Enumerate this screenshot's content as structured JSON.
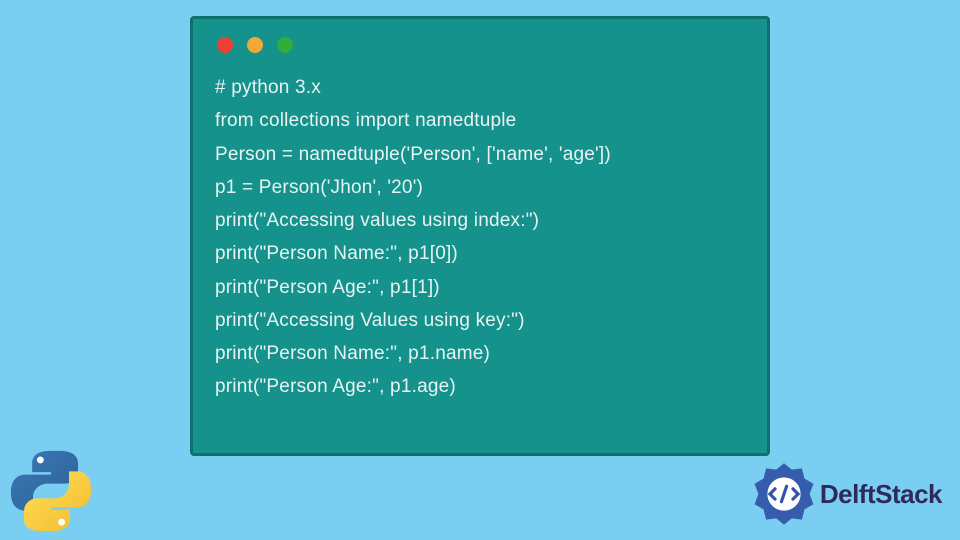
{
  "code": {
    "lines": [
      "# python 3.x",
      "from collections import namedtuple",
      "Person = namedtuple('Person', ['name', 'age'])",
      "p1 = Person('Jhon', '20')",
      "print(\"Accessing values using index:\")",
      "print(\"Person Name:\", p1[0])",
      "print(\"Person Age:\", p1[1])",
      "print(\"Accessing Values using key:\")",
      "print(\"Person Name:\", p1.name)",
      "print(\"Person Age:\", p1.age)"
    ]
  },
  "brand": {
    "name": "DelftStack"
  },
  "colors": {
    "background": "#79cef2",
    "window_bg": "#15928b",
    "window_border": "#0e726c",
    "code_text": "#e8f4f3",
    "brand_text": "#2f2a5a",
    "brand_accent": "#3256a8"
  }
}
